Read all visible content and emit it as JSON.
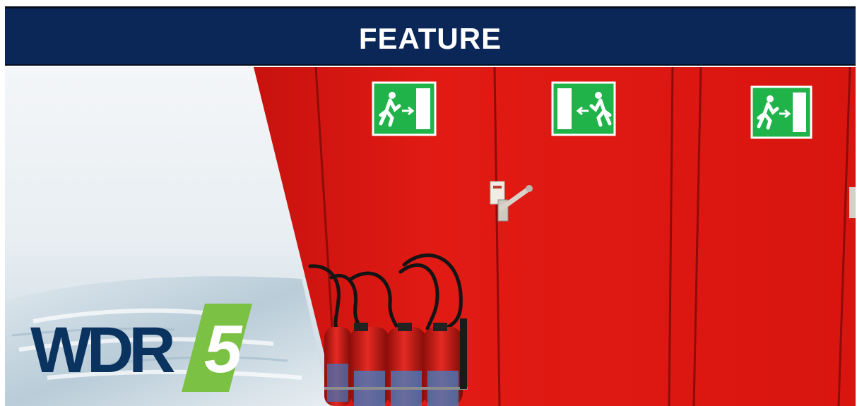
{
  "banner": {
    "title": "FEATURE"
  },
  "logo": {
    "text": "WDR",
    "number": "5",
    "icon": "wdr5-logo"
  },
  "colors": {
    "banner_bg": "#0b2758",
    "logo_blue": "#0a3360",
    "logo_green": "#7bc143",
    "wall_red": "#e01712",
    "sign_green": "#1fb34a"
  }
}
